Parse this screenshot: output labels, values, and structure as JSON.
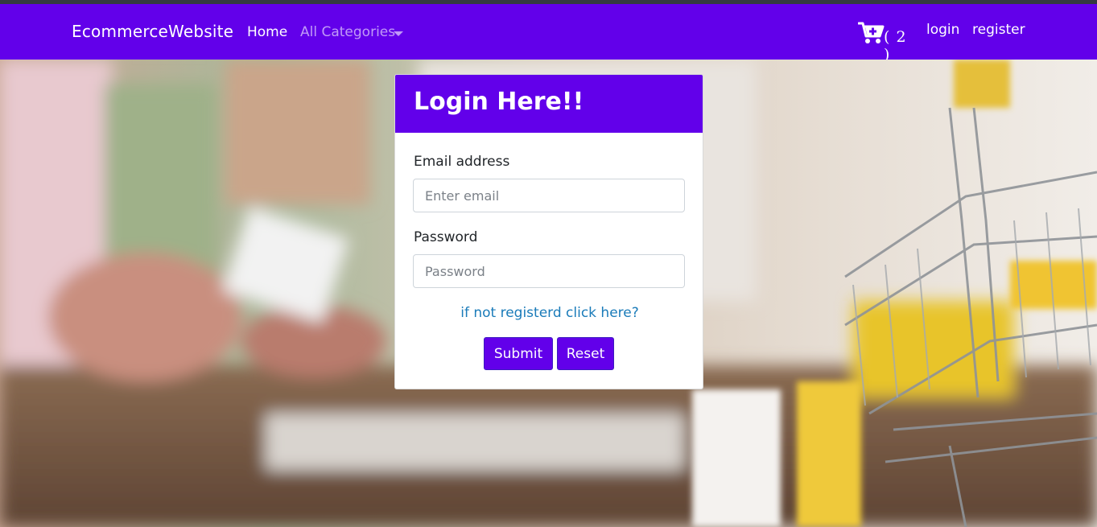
{
  "navbar": {
    "brand": "EcommerceWebsite",
    "home": "Home",
    "categories": "All Categories",
    "cart_count": "( 2 )",
    "login": "login",
    "register": "register"
  },
  "login_card": {
    "title": "Login Here!!",
    "email_label": "Email address",
    "email_placeholder": "Enter email",
    "password_label": "Password",
    "password_placeholder": "Password",
    "register_link": "if not registerd click here?",
    "submit": "Submit",
    "reset": "Reset"
  },
  "icons": {
    "cart": "cart-plus-icon",
    "dropdown": "caret-down-icon"
  },
  "colors": {
    "primary": "#6200ea",
    "link": "#1a7bb9"
  }
}
